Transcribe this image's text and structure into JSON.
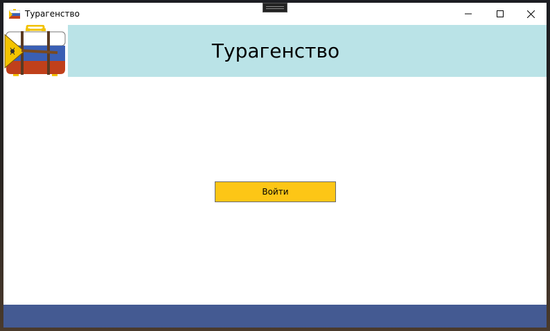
{
  "window": {
    "title": "Турагенство",
    "controls": {
      "minimize_icon": "minimize-icon",
      "maximize_icon": "maximize-icon",
      "close_icon": "close-icon"
    }
  },
  "header": {
    "title": "Турагенство",
    "logo_icon": "suitcase-flag-logo"
  },
  "main": {
    "login_label": "Войти"
  },
  "colors": {
    "header_bg": "#bae3e7",
    "button_bg": "#fdc616",
    "footer_bg": "#445a92"
  }
}
